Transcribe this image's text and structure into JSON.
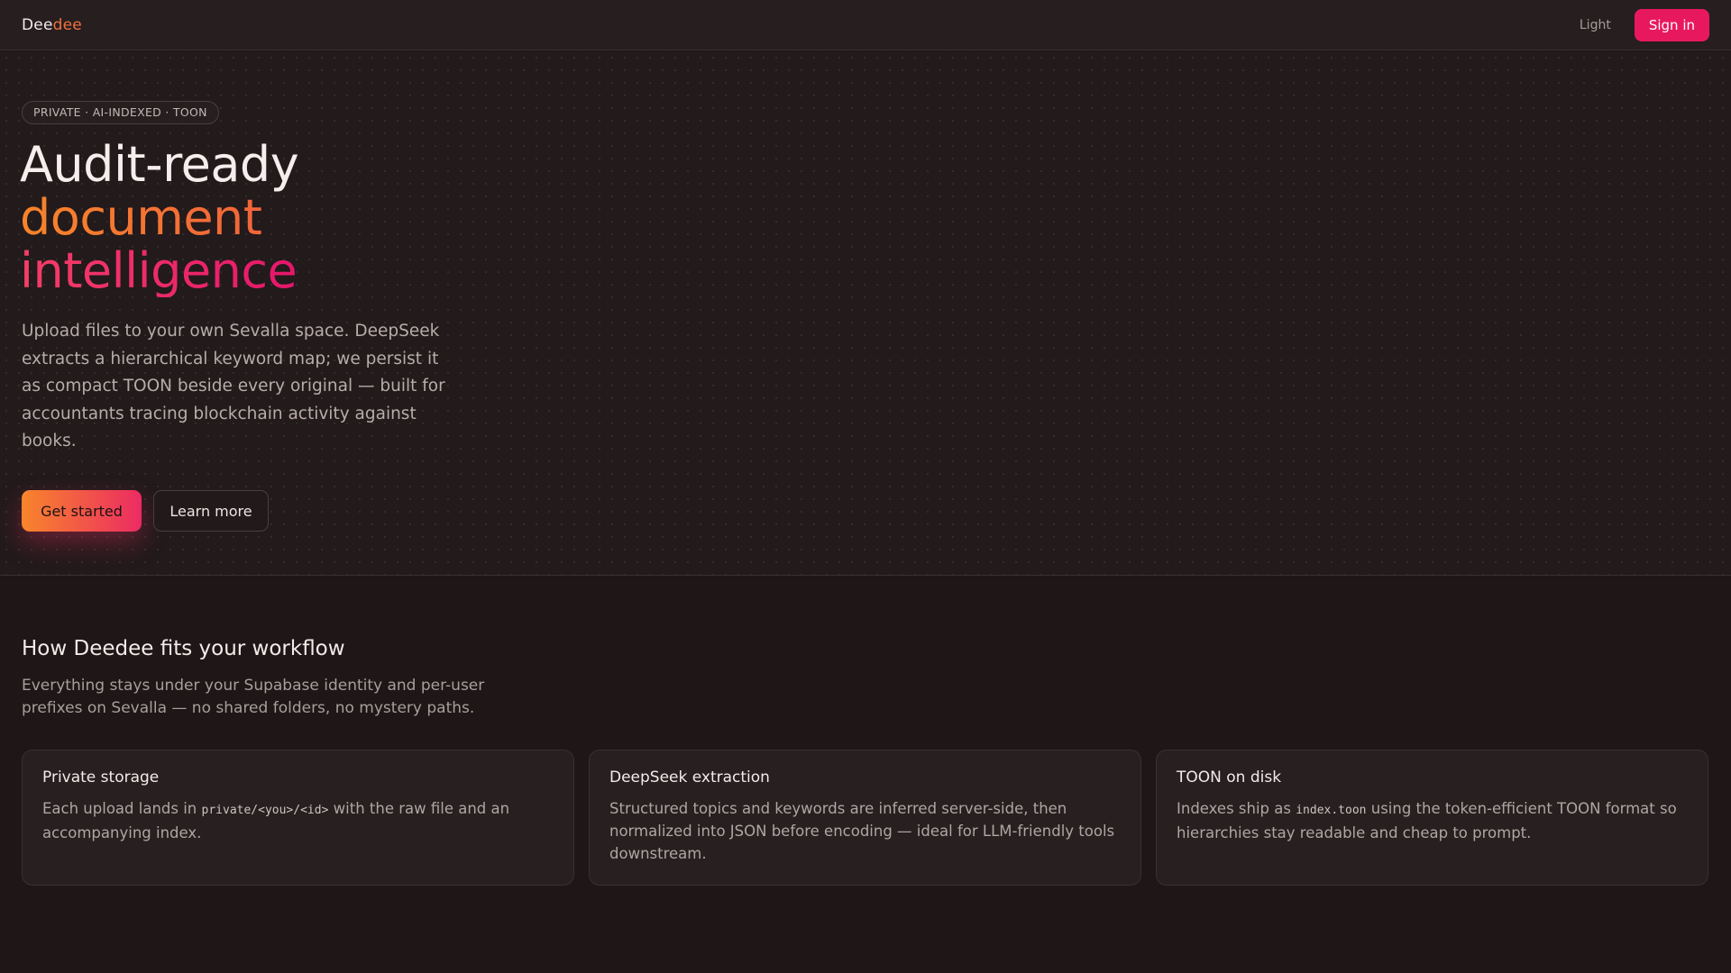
{
  "header": {
    "brand_part1": "Dee",
    "brand_part2": "dee",
    "theme_toggle": "Light",
    "signin_label": "Sign in"
  },
  "hero": {
    "pill": "PRIVATE · AI-INDEXED · TOON",
    "headline_line1": "Audit-ready",
    "headline_line2": "document",
    "headline_line3": "intelligence",
    "lede": "Upload files to your own Sevalla space. DeepSeek extracts a hierarchical keyword map; we persist it as compact TOON beside every original — built for accountants tracing blockchain activity against books.",
    "cta_primary": "Get started",
    "cta_secondary": "Learn more"
  },
  "workflow": {
    "title": "How Deedee fits your workflow",
    "subtitle": "Everything stays under your Supabase identity and per-user prefixes on Sevalla — no shared folders, no mystery paths.",
    "cards": [
      {
        "title": "Private storage",
        "body_pre": "Each upload lands in ",
        "body_code": "private/<you>/<id>",
        "body_post": " with the raw file and an accompanying index."
      },
      {
        "title": "DeepSeek extraction",
        "body": "Structured topics and keywords are inferred server-side, then normalized into JSON before encoding — ideal for LLM-friendly tools downstream."
      },
      {
        "title": "TOON on disk",
        "body_pre": "Indexes ship as ",
        "body_code": "index.toon",
        "body_post": " using the token-efficient TOON format so hierarchies stay readable and cheap to prompt."
      }
    ]
  },
  "colors": {
    "background": "#1e1617",
    "accent_pink": "#e8185f",
    "accent_orange": "#f7842a"
  }
}
